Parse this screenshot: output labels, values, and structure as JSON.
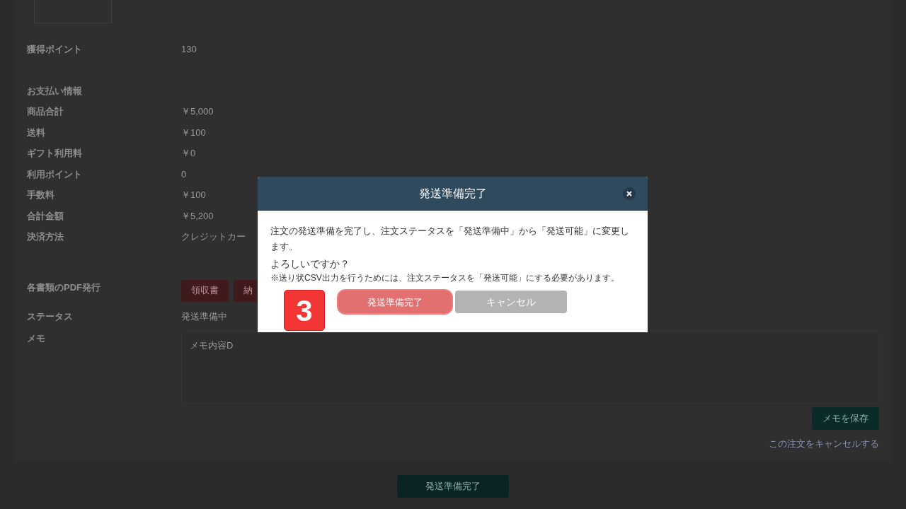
{
  "order_points": {
    "label": "獲得ポイント",
    "value": "130"
  },
  "payment": {
    "heading": "お支払い情報",
    "rows": [
      {
        "label": "商品合計",
        "value": "￥5,000"
      },
      {
        "label": "送料",
        "value": "￥100"
      },
      {
        "label": "ギフト利用料",
        "value": "￥0"
      },
      {
        "label": "利用ポイント",
        "value": "0"
      },
      {
        "label": "手数料",
        "value": "￥100"
      },
      {
        "label": "合計金額",
        "value": "￥5,200"
      },
      {
        "label": "決済方法",
        "value": "クレジットカー"
      }
    ]
  },
  "pdf": {
    "label": "各書類のPDF発行",
    "buttons": [
      "領収書",
      "納"
    ]
  },
  "status": {
    "label": "ステータス",
    "value": "発送準備中"
  },
  "memo": {
    "label": "メモ",
    "value": "メモ内容D",
    "save_button": "メモを保存",
    "cancel_link": "この注文をキャンセルする"
  },
  "footer_button": "発送準備完了",
  "modal": {
    "title": "発送準備完了",
    "message": "注文の発送準備を完了し、注文ステータスを「発送準備中」から「発送可能」に変更します。",
    "question": "よろしいですか？",
    "note": "※送り状CSV出力を行うためには、注文ステータスを「発送可能」にする必要があります。",
    "confirm_button": "発送準備完了",
    "cancel_button": "キャンセル",
    "step_badge": "3"
  }
}
